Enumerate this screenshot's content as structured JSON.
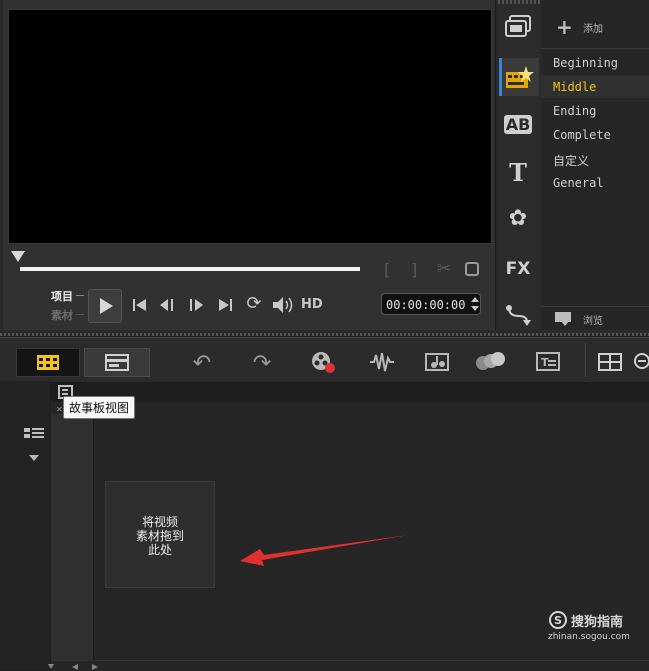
{
  "preview": {
    "mode_project": "项目",
    "mode_clip": "素材",
    "timecode": "00:00:00:00",
    "hd_label": "HD"
  },
  "side_toolbar": {
    "icons": [
      "media-icon",
      "instant-project-icon",
      "transition-icon",
      "title-icon",
      "graphic-icon",
      "filter-icon",
      "path-icon"
    ]
  },
  "library": {
    "add_label": "添加",
    "browse_label": "浏览",
    "items": [
      "Beginning",
      "Middle",
      "Ending",
      "Complete",
      "自定义",
      "General"
    ],
    "selected_index": 1
  },
  "timeline": {
    "tooltip": "故事板视图",
    "drop_hint": "将视频\n素材拖到\n此处"
  },
  "watermark": {
    "brand": "搜狗指南",
    "url": "zhinan.sogou.com"
  },
  "colors": {
    "accent_blue": "#3b86d6",
    "selected_text": "#f0c419",
    "arrow_red": "#e03131"
  }
}
